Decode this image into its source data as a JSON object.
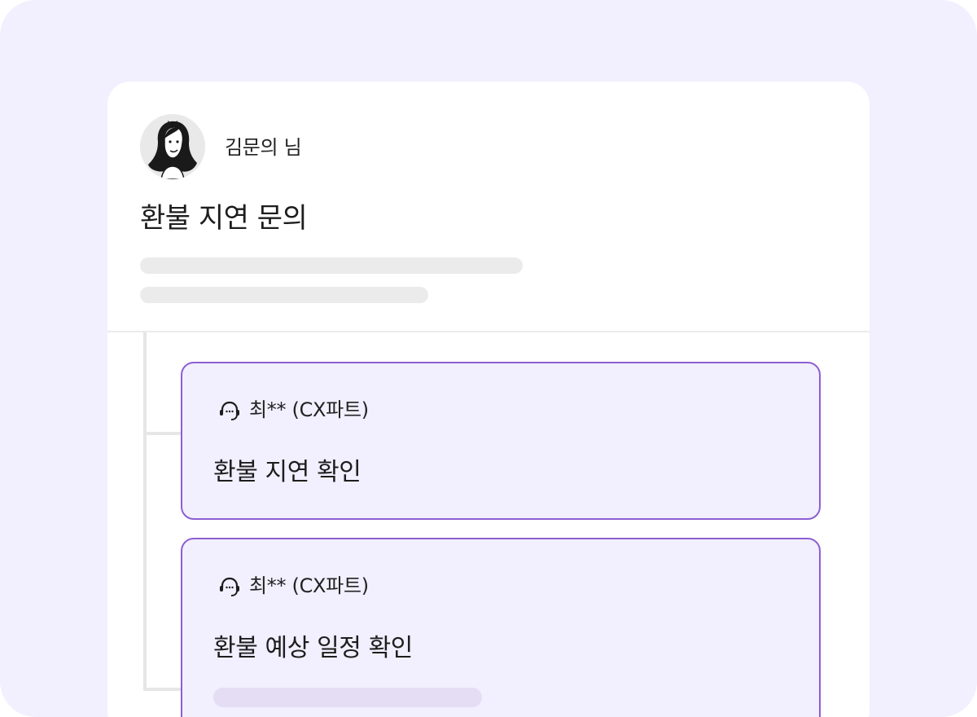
{
  "post": {
    "author_name": "김문의 님",
    "title": "환불 지연 문의"
  },
  "replies": [
    {
      "agent": "최** (CX파트)",
      "text": "환불 지연 확인",
      "icon": "headset-icon"
    },
    {
      "agent": "최** (CX파트)",
      "text": "환불 예상 일정 확인",
      "icon": "headset-icon"
    }
  ],
  "colors": {
    "background": "#f2effe",
    "accent_border": "#8d5fd3",
    "skeleton": "#ebebeb",
    "reply_skeleton": "#e4ddf4"
  }
}
